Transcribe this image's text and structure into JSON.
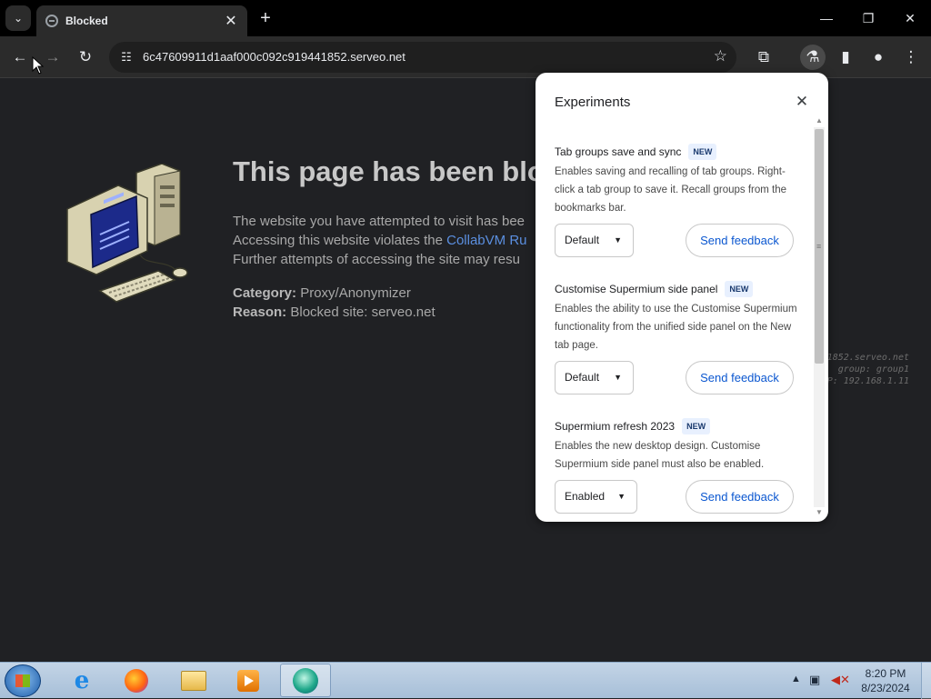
{
  "browser": {
    "tab": {
      "title": "Blocked",
      "close": "✕"
    },
    "url": "6c47609911d1aaf000c092c919441852.serveo.net",
    "window_controls": {
      "minimize": "—",
      "maximize": "❐",
      "close": "✕"
    }
  },
  "page": {
    "title": "This page has been blo",
    "line1": "The website you have attempted to visit has bee",
    "line2_prefix": "Accessing this website violates the ",
    "line2_link": "CollabVM Ru",
    "line3": "Further attempts of accessing the site may resu",
    "category_label": "Category:",
    "category_value": "Proxy/Anonymizer",
    "reason_label": "Reason:",
    "reason_value": "Blocked site: serveo.net",
    "side_line1": "1852.serveo.net",
    "side_line2": "group: group1",
    "side_line3": "P: 192.168.1.11"
  },
  "experiments": {
    "title": "Experiments",
    "close": "✕",
    "items": [
      {
        "name": "Tab groups save and sync",
        "badge": "NEW",
        "description": "Enables saving and recalling of tab groups. Right-click a tab group to save it. Recall groups from the bookmarks bar.",
        "selected": "Default",
        "feedback": "Send feedback"
      },
      {
        "name": "Customise Supermium side panel",
        "badge": "NEW",
        "description": "Enables the ability to use the Customise Supermium functionality from the unified side panel on the New tab page.",
        "selected": "Default",
        "feedback": "Send feedback"
      },
      {
        "name": "Supermium refresh 2023",
        "badge": "NEW",
        "description": "Enables the new desktop design. Customise Supermium side panel must also be enabled.",
        "selected": "Enabled",
        "feedback": "Send feedback"
      }
    ]
  },
  "taskbar": {
    "time": "8:20 PM",
    "date": "8/23/2024"
  }
}
